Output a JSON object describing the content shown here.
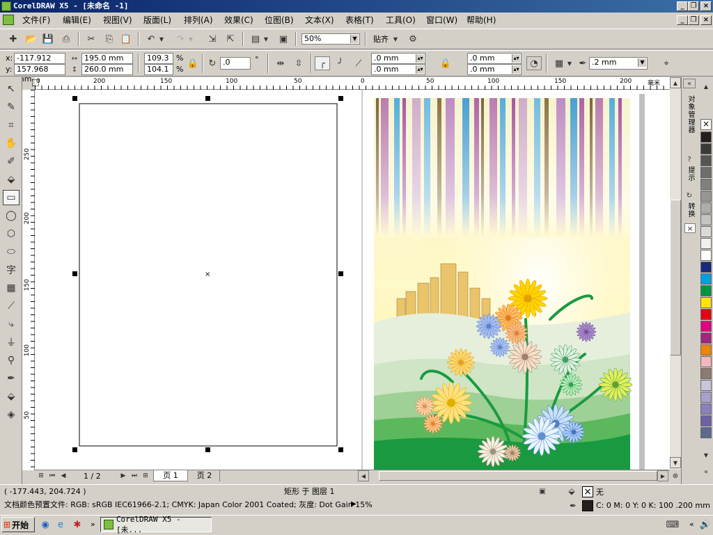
{
  "window": {
    "title": "CorelDRAW X5 - [未命名 -1]"
  },
  "menubar": {
    "items": [
      "文件(F)",
      "编辑(E)",
      "视图(V)",
      "版面(L)",
      "排列(A)",
      "效果(C)",
      "位图(B)",
      "文本(X)",
      "表格(T)",
      "工具(O)",
      "窗口(W)",
      "帮助(H)"
    ]
  },
  "toolbar1": {
    "zoom": "50%",
    "snap_label": "贴齐"
  },
  "propbar": {
    "x_label": "x:",
    "y_label": "y:",
    "x_value": "-117.912 mm",
    "y_value": "157.968 mm",
    "width_value": "195.0 mm",
    "height_value": "260.0 mm",
    "scale_x": "109.3",
    "scale_y": "104.1",
    "percent": "%",
    "rotation": ".0",
    "degree": "°",
    "corner1": ".0 mm",
    "corner2": ".0 mm",
    "corner3": ".0 mm",
    "corner4": ".0 mm",
    "outline_width": ".2 mm"
  },
  "ruler": {
    "h_labels": [
      "0",
      "200",
      "150",
      "100",
      "50",
      "0",
      "50",
      "100",
      "150",
      "200"
    ],
    "unit": "毫米",
    "v_labels": [
      "250",
      "200",
      "150",
      "100",
      "50"
    ]
  },
  "pagetabs": {
    "page_count": "1 / 2",
    "page1": "页 1",
    "page2": "页 2"
  },
  "docker": {
    "tab1": "对象管理器",
    "tab2": "提示",
    "tab3": "转换"
  },
  "palette": {
    "colors": [
      "#231f20",
      "#3a3a3a",
      "#555555",
      "#6d6d6d",
      "#808080",
      "#969696",
      "#adadad",
      "#c4c4c4",
      "#dadada",
      "#f0f0f0",
      "#ffffff",
      "#1a2a7a",
      "#00a0e0",
      "#00963f",
      "#ffe600",
      "#e60012",
      "#e4007f",
      "#a0267e",
      "#f08300",
      "#f4b6bf",
      "#8c7b70",
      "#c9c5de",
      "#a8a0cc",
      "#8a80bb",
      "#6c62a8",
      "#5c6a90"
    ]
  },
  "status": {
    "coords": "( -177.443, 204.724 )",
    "object_info": "矩形 于 图层 1",
    "fill_none": "无",
    "color_profile": "文档颜色预置文件: RGB: sRGB IEC61966-2.1; CMYK: Japan Color 2001 Coated; 灰度: Dot Gain 15%",
    "outline_info": "C: 0 M: 0 Y: 0 K: 100  .200 mm"
  },
  "taskbar": {
    "start": "开始",
    "app": "CorelDRAW X5 - [未..."
  }
}
